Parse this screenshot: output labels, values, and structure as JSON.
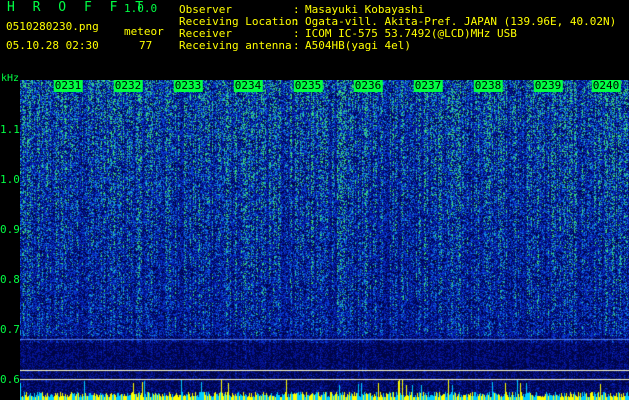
{
  "header": {
    "app_title": "H R O F F T",
    "version": "1.0.0",
    "file_name": "0510280230.png",
    "mode": "meteor",
    "datetime": "05.10.28 02:30",
    "count": "77"
  },
  "info": [
    {
      "label": "Observer",
      "value": "Masayuki Kobayashi"
    },
    {
      "label": "Receiving Location",
      "value": "Ogata-vill. Akita-Pref. JAPAN (139.96E, 40.02N)"
    },
    {
      "label": "Receiver",
      "value": "ICOM IC-575 53.7492(@LCD)MHz USB"
    },
    {
      "label": "Receiving antenna",
      "value": "A504HB(yagi 4el)"
    }
  ],
  "spectrogram": {
    "y_unit": "kHz",
    "y_ticks": [
      "1.1",
      "1.0",
      "0.9",
      "0.8",
      "0.7",
      "0.6"
    ],
    "x_ticks": [
      "0231",
      "0232",
      "0233",
      "0234",
      "0235",
      "0236",
      "0237",
      "0238",
      "0239",
      "0240"
    ],
    "colors": {
      "background": "#000000",
      "label": "#00ff44",
      "info": "#ffff00",
      "signal": "#0033cc"
    }
  }
}
